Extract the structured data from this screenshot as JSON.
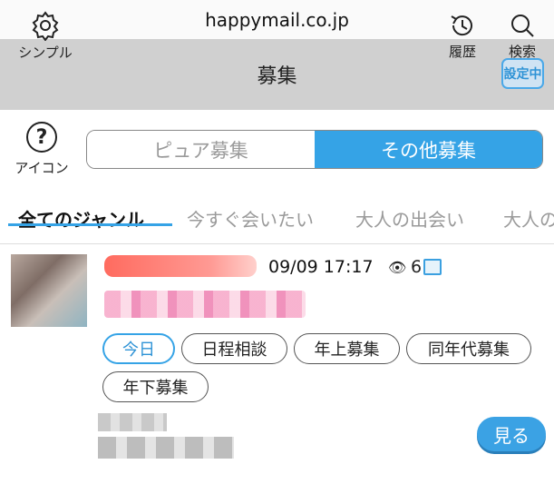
{
  "browser": {
    "url": "happymail.co.jp"
  },
  "header": {
    "title": "募集",
    "simple_label": "シンプル",
    "history_label": "履歴",
    "search_label": "検索",
    "search_badge": "設定中"
  },
  "filter": {
    "icon_label": "アイコン",
    "icon_glyph": "?",
    "tabs": [
      {
        "label": "ピュア募集",
        "selected": false
      },
      {
        "label": "その他募集",
        "selected": true
      }
    ]
  },
  "genres": [
    {
      "label": "全てのジャンル",
      "active": true
    },
    {
      "label": "今すぐ会いたい",
      "active": false
    },
    {
      "label": "大人の出会い",
      "active": false
    },
    {
      "label": "大人の",
      "active": false
    }
  ],
  "post": {
    "datetime": "09/09 17:17",
    "eye_glyph": "👁",
    "views": "6",
    "tags": [
      "今日",
      "日程相談",
      "年上募集",
      "同年代募集",
      "年下募集"
    ],
    "view_button": "見る"
  },
  "colors": {
    "accent": "#35a3e6",
    "header_bg": "#d0d0d0"
  },
  "icons": [
    "gear-icon",
    "history-clock-icon",
    "search-icon",
    "help-circle-icon",
    "eye-icon",
    "image-icon"
  ]
}
